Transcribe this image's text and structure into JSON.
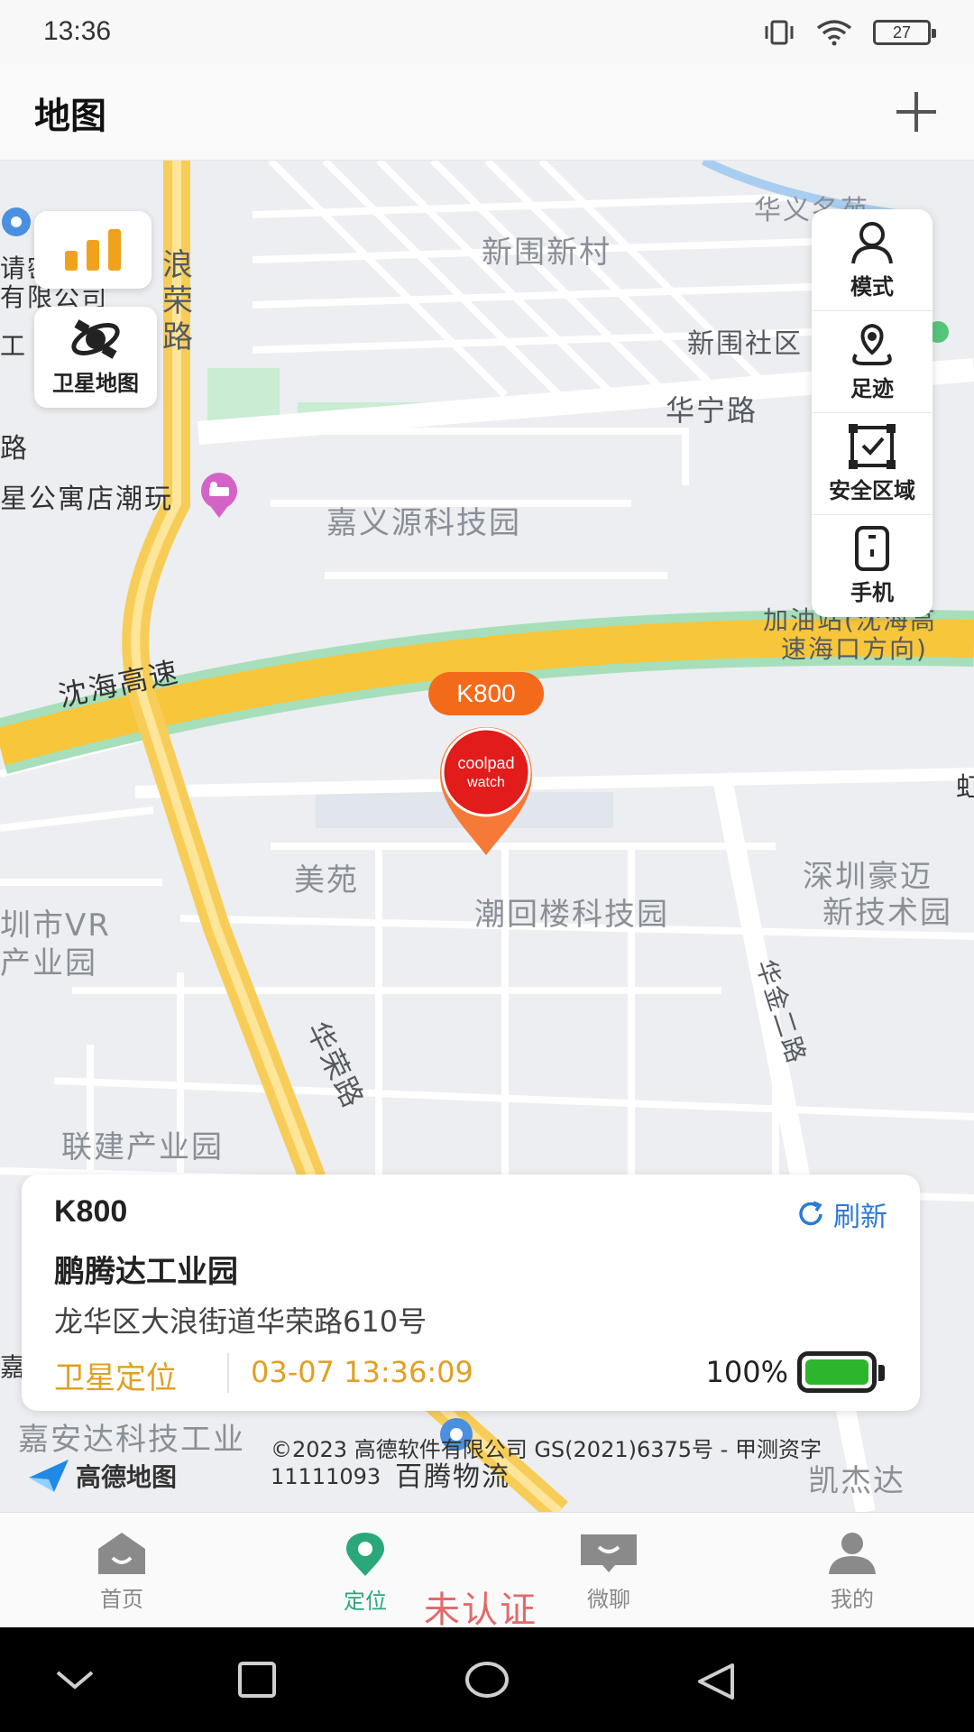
{
  "status_bar": {
    "time": "13:36",
    "battery": "27"
  },
  "header": {
    "title": "地图"
  },
  "map": {
    "left_controls": {
      "satellite_label": "卫星地图"
    },
    "right_controls": [
      {
        "label": "模式"
      },
      {
        "label": "足迹"
      },
      {
        "label": "安全区域"
      },
      {
        "label": "手机"
      }
    ],
    "labels": {
      "xinwei_village": "新围新村",
      "xinwei_community": "新围社区",
      "huaning_road": "华宁路",
      "langrong_road": "浪荣路",
      "jiayiyuan_park": "嘉义源科技园",
      "shenhai_highway": "沈海高速",
      "gas_station": "加油站(沈海高",
      "gas_station2": "速海口方向)",
      "meiyuan": "美苑",
      "chaohuilou_park": "潮回楼科技园",
      "shenzhen_haomai": "深圳豪迈",
      "new_tech": "新技术园",
      "huajin2_road": "华金二路",
      "huarong_road": "华荣路",
      "lianjian_park": "联建产业园",
      "vr_city": "圳市VR",
      "vr_park": "产业园",
      "apartment": "星公寓店潮玩",
      "jiaanda": "嘉安达科技工业",
      "baiteng": "百腾物流",
      "kaijieda": "凯杰达",
      "company_left": "有限公司",
      "road_left": "路",
      "left_top": "请密",
      "left_gong": "工",
      "huayi": "华义名苑",
      "left_jia": "嘉",
      "right_hong": "虹"
    },
    "device_tag": "K800",
    "marker_brand_line1": "coolpad",
    "marker_brand_line2": "watch",
    "attribution": {
      "logo_text": "高德地图",
      "copyright": "©2023 高德软件有限公司 GS(2021)6375号 - 甲测资字 11111093"
    }
  },
  "info_card": {
    "device_name": "K800",
    "refresh_label": "刷新",
    "place_name": "鹏腾达工业园",
    "address": "龙华区大浪街道华荣路610号",
    "location_type": "卫星定位",
    "timestamp": "03-07 13:36:09",
    "battery_percent": "100%"
  },
  "bottom_nav": [
    {
      "label": "首页"
    },
    {
      "label": "定位",
      "active": true
    },
    {
      "label": "微聊"
    },
    {
      "label": "我的"
    }
  ],
  "watermark": "未认证",
  "colors": {
    "accent_green": "#2aa87a",
    "location_orange": "#e0a023",
    "refresh_blue": "#2a7ad4",
    "marker_orange": "#f36a1b",
    "battery_green": "#2db52d"
  }
}
